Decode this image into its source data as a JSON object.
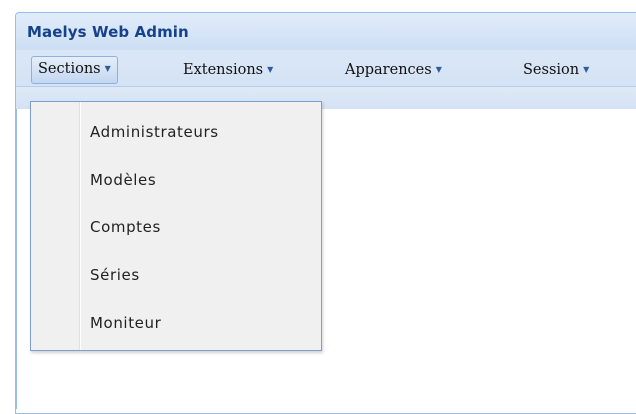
{
  "app": {
    "title": "Maelys Web Admin"
  },
  "menubar": {
    "items": [
      {
        "label": "Sections",
        "caret": "▼"
      },
      {
        "label": "Extensions",
        "caret": "▼"
      },
      {
        "label": "Apparences",
        "caret": "▼"
      },
      {
        "label": "Session",
        "caret": "▼"
      }
    ]
  },
  "dropdown": {
    "items": [
      {
        "label": "Administrateurs"
      },
      {
        "label": "Modèles"
      },
      {
        "label": "Comptes"
      },
      {
        "label": "Séries"
      },
      {
        "label": "Moniteur"
      }
    ]
  },
  "colors": {
    "title": "#15428b",
    "border": "#99bbe8",
    "menu_bg": "#f0f0f0"
  }
}
